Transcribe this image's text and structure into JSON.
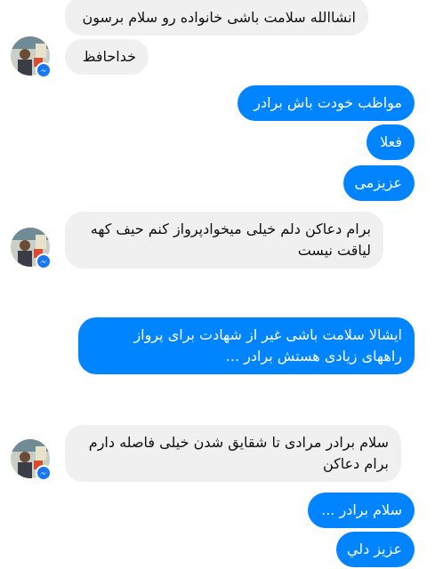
{
  "conversation": {
    "messages": [
      {
        "text": "انشاالله سلامت باشی خانواده رو سلام برسون",
        "sender": "contact"
      },
      {
        "text": "خداحافظ",
        "sender": "contact"
      },
      {
        "text": "مواظب خودت باش برادر",
        "sender": "me"
      },
      {
        "text": "فعلا",
        "sender": "me"
      },
      {
        "text": "عزیزمی",
        "sender": "me"
      },
      {
        "lines": [
          "برام دعاکن دلم خیلی میخوادپرواز کنم حیف کهه",
          "لیاقت نیست"
        ],
        "sender": "contact"
      },
      {
        "lines": [
          "ایشالا سلامت باشی غیر از شهادت برای پرواز",
          "راههای زیادی هستش برادر ..."
        ],
        "sender": "me"
      },
      {
        "lines": [
          "سلام برادر مرادی تا شقایق شدن خیلی فاصله دارم",
          "برام دعاکن"
        ],
        "sender": "contact"
      },
      {
        "text": "سلام برادر ...",
        "sender": "me"
      },
      {
        "text": "عزیز دلي",
        "sender": "me"
      }
    ]
  },
  "avatar": {
    "icon": "profile-photo-icon",
    "badge_icon": "messenger-badge-icon"
  },
  "colors": {
    "outgoing_bubble": "#0084ff",
    "incoming_bubble": "#f0f0f0",
    "badge": "#1877f2"
  }
}
